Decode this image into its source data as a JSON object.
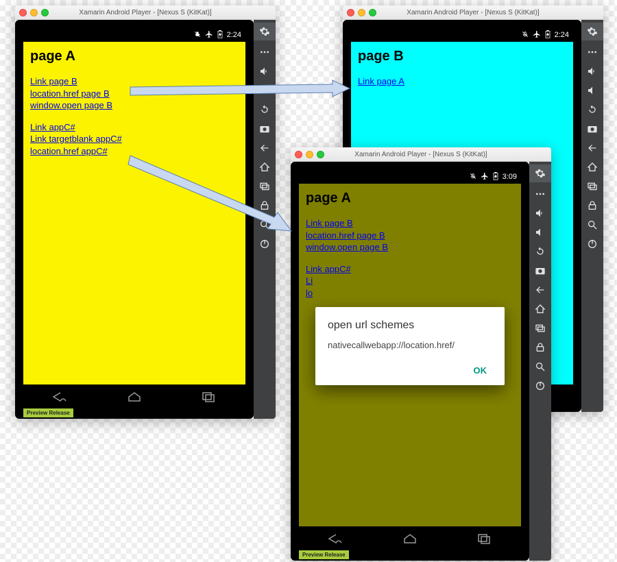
{
  "emus": {
    "a": {
      "title": "Xamarin Android Player - [Nexus S (KitKat)]",
      "status_time": "2:24",
      "page_title": "page A",
      "links1": [
        "Link page B",
        "location.href page B",
        "window.open page B"
      ],
      "links2": [
        "Link appC#",
        "Link targetblank appC#",
        "location.href appC#"
      ],
      "preview": "Preview Release"
    },
    "b": {
      "title": "Xamarin Android Player - [Nexus S (KitKat)]",
      "status_time": "2:24",
      "page_title": "page B",
      "links1": [
        "Link page A"
      ]
    },
    "c": {
      "title": "Xamarin Android Player - [Nexus S (KitKat)]",
      "status_time": "3:09",
      "page_title": "page A",
      "links1": [
        "Link page B",
        "location.href page B",
        "window.open page B"
      ],
      "links2_vis": [
        "Link appC#",
        "Li",
        "lo"
      ],
      "dialog": {
        "title": "open url schemes",
        "message": "nativecallwebapp://location.href/",
        "ok": "OK"
      },
      "preview": "Preview Release"
    }
  },
  "toolbar_names": [
    "settings",
    "more",
    "volume-up",
    "volume-down",
    "rotate",
    "camera",
    "back",
    "home",
    "recent",
    "lock",
    "search",
    "power"
  ]
}
